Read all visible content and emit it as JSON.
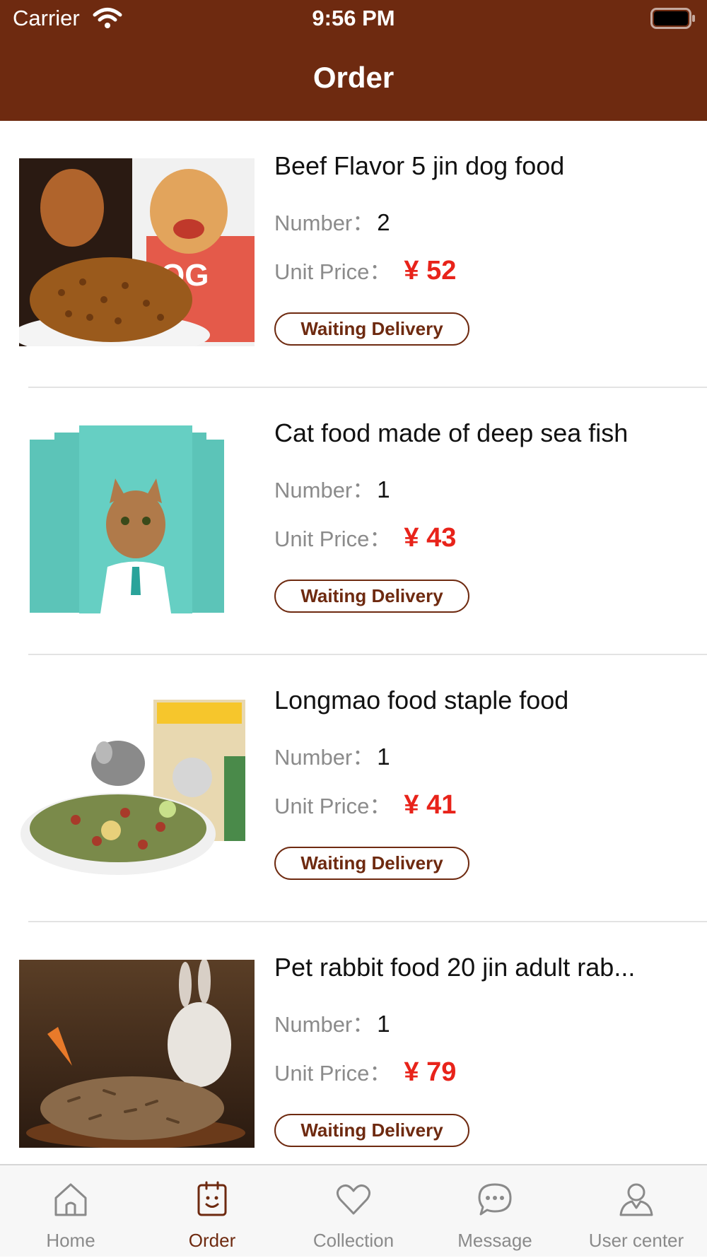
{
  "status_bar": {
    "carrier": "Carrier",
    "time": "9:56 PM"
  },
  "header": {
    "title": "Order"
  },
  "colors": {
    "brand": "#6e2a10",
    "price": "#e8231a",
    "muted": "#8b8b8b"
  },
  "orders": [
    {
      "title": "Beef Flavor 5 jin dog food",
      "number_label": "Number：",
      "number": "2",
      "price_label": "Unit Price：",
      "price": "¥ 52",
      "status": "Waiting Delivery",
      "image": "dog-food-image"
    },
    {
      "title": "Cat food made of deep sea fish",
      "number_label": "Number：",
      "number": "1",
      "price_label": "Unit Price：",
      "price": "¥ 43",
      "status": "Waiting Delivery",
      "image": "cat-food-image"
    },
    {
      "title": "Longmao food staple food",
      "number_label": "Number：",
      "number": "1",
      "price_label": "Unit Price：",
      "price": "¥ 41",
      "status": "Waiting Delivery",
      "image": "chinchilla-food-image"
    },
    {
      "title": "Pet rabbit food 20 jin adult rab...",
      "number_label": "Number：",
      "number": "1",
      "price_label": "Unit Price：",
      "price": "¥ 79",
      "status": "Waiting Delivery",
      "image": "rabbit-food-image"
    }
  ],
  "tabbar": {
    "active": "Order",
    "items": [
      {
        "label": "Home",
        "icon": "home-icon"
      },
      {
        "label": "Order",
        "icon": "order-icon"
      },
      {
        "label": "Collection",
        "icon": "heart-icon"
      },
      {
        "label": "Message",
        "icon": "message-icon"
      },
      {
        "label": "User center",
        "icon": "user-icon"
      }
    ]
  }
}
